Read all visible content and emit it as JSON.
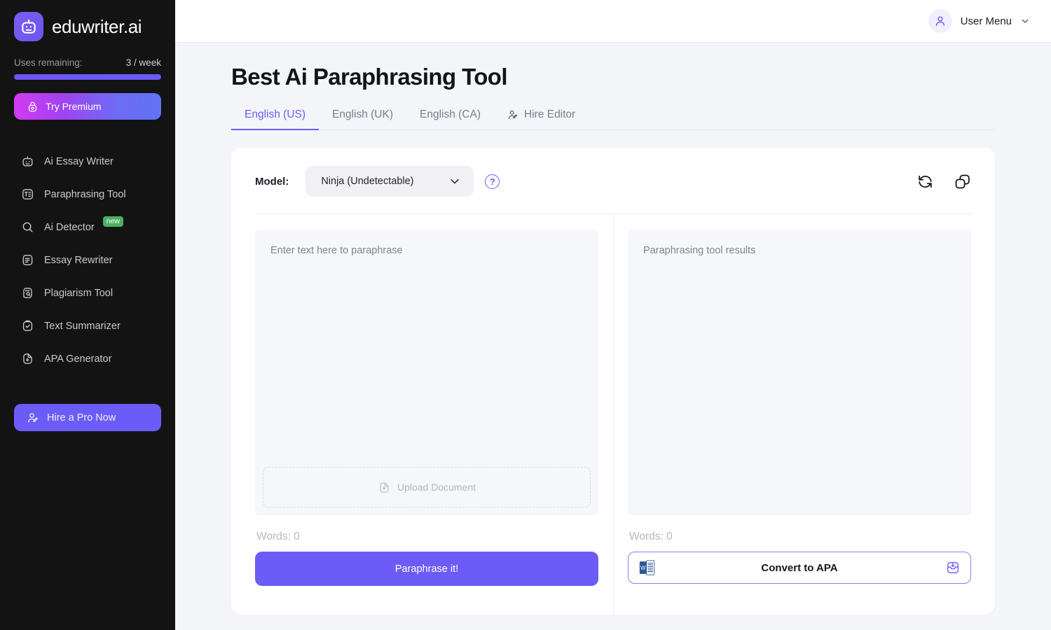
{
  "brand": {
    "name": "eduwriter.ai",
    "logo_icon": "robot-icon"
  },
  "sidebar": {
    "uses_label": "Uses remaining:",
    "uses_value": "3 / week",
    "progress_percent": 100,
    "premium": {
      "label": "Try Premium",
      "icon": "premium-lock-icon"
    },
    "items": [
      {
        "label": "Ai Essay Writer",
        "icon": "robot-icon",
        "badge": ""
      },
      {
        "label": "Paraphrasing Tool",
        "icon": "paraphrase-icon",
        "badge": ""
      },
      {
        "label": "Ai Detector",
        "icon": "search-icon",
        "badge": "new"
      },
      {
        "label": "Essay Rewriter",
        "icon": "document-lines-icon",
        "badge": ""
      },
      {
        "label": "Plagiarism Tool",
        "icon": "document-search-icon",
        "badge": ""
      },
      {
        "label": "Text Summarizer",
        "icon": "clipboard-check-icon",
        "badge": ""
      },
      {
        "label": "APA Generator",
        "icon": "file-download-icon",
        "badge": ""
      }
    ],
    "hire_pro": {
      "label": "Hire a Pro Now",
      "icon": "user-edit-icon"
    }
  },
  "topbar": {
    "user_menu_label": "User Menu",
    "avatar_icon": "user-icon",
    "chevron_icon": "chevron-down-icon"
  },
  "main": {
    "page_title": "Best Ai Paraphrasing Tool",
    "tabs": [
      {
        "label": "English (US)",
        "active": true,
        "icon": ""
      },
      {
        "label": "English (UK)",
        "active": false,
        "icon": ""
      },
      {
        "label": "English (CA)",
        "active": false,
        "icon": ""
      },
      {
        "label": "Hire Editor",
        "active": false,
        "icon": "user-edit-icon"
      }
    ],
    "model": {
      "label": "Model:",
      "selected": "Ninja (Undetectable)",
      "chevron_icon": "chevron-down-icon",
      "help_icon": "question-mark-icon",
      "help_glyph": "?"
    },
    "card_actions": [
      {
        "icon": "refresh-icon",
        "name": "refresh-button"
      },
      {
        "icon": "copy-icon",
        "name": "copy-button"
      }
    ],
    "input_panel": {
      "placeholder": "Enter text here to paraphrase",
      "upload_label": "Upload Document",
      "upload_icon": "file-upload-icon",
      "words_label": "Words: 0",
      "submit_label": "Paraphrase it!"
    },
    "output_panel": {
      "placeholder": "Paraphrasing tool results",
      "words_label": "Words: 0",
      "convert_label": "Convert to APA",
      "word_doc_icon": "word-document-icon",
      "download_icon": "download-tray-icon"
    }
  },
  "colors": {
    "accent": "#6c5cf7",
    "sidebar_bg": "#131313",
    "page_bg": "#f4f5f9",
    "badge_green": "#4caf63",
    "editor_bg": "#f6f7fb"
  }
}
